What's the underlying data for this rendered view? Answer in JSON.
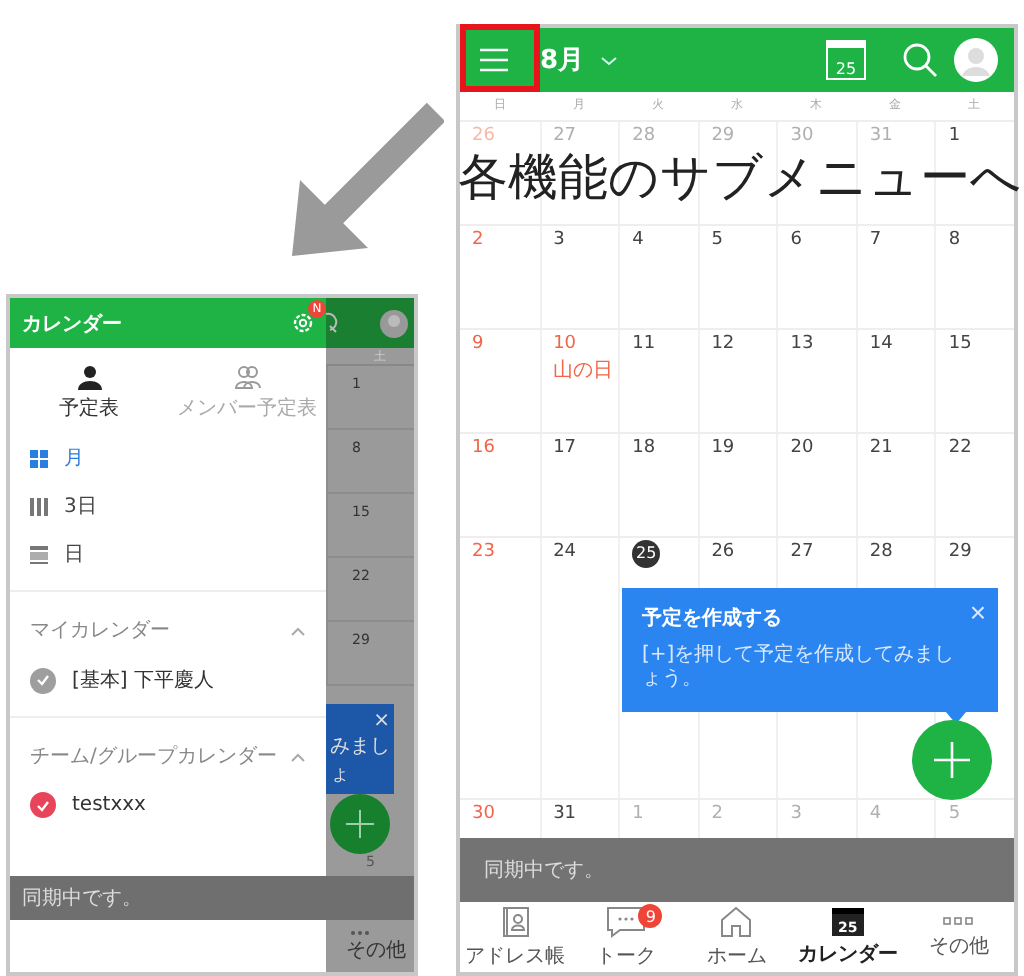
{
  "annotation": {
    "text": "各機能のサブメニューへ"
  },
  "drawer_screen": {
    "header_title": "カレンダー",
    "settings_badge": "N",
    "view_tabs": [
      {
        "label": "予定表",
        "selected": true,
        "kind": "single"
      },
      {
        "label": "メンバー予定表",
        "selected": false,
        "kind": "members"
      }
    ],
    "views": [
      {
        "label": "月",
        "selected": true,
        "kind": "month"
      },
      {
        "label": "3日",
        "selected": false,
        "kind": "three-day"
      },
      {
        "label": "日",
        "selected": false,
        "kind": "day"
      }
    ],
    "sections": [
      {
        "title": "マイカレンダー",
        "expanded": true,
        "calendars": [
          {
            "name": "[基本] 下平慶人",
            "color": "#9e9e9e"
          }
        ]
      },
      {
        "title": "チーム/グループカレンダー",
        "expanded": true,
        "calendars": [
          {
            "name": "testxxx",
            "color": "#e8455a"
          }
        ]
      }
    ],
    "background": {
      "weekday": "土",
      "dates": [
        "1",
        "8",
        "15",
        "22",
        "29"
      ],
      "tooltip_close": "×",
      "tooltip_fragment": "みましょ",
      "last_date": "5",
      "tab_label": "その他"
    },
    "status": "同期中です。"
  },
  "calendar_screen": {
    "month": "8月",
    "today_icon": "25",
    "weekdays": [
      "日",
      "月",
      "火",
      "水",
      "木",
      "金",
      "土"
    ],
    "weeks": [
      [
        {
          "date": "26",
          "kind": "sunday",
          "outside": true
        },
        {
          "date": "27",
          "kind": "weekday",
          "outside": true
        },
        {
          "date": "28",
          "kind": "weekday",
          "outside": true
        },
        {
          "date": "29",
          "kind": "weekday",
          "outside": true
        },
        {
          "date": "30",
          "kind": "weekday",
          "outside": true
        },
        {
          "date": "31",
          "kind": "weekday",
          "outside": true
        },
        {
          "date": "1",
          "kind": "weekday",
          "outside": false
        }
      ],
      [
        {
          "date": "2",
          "kind": "sunday",
          "outside": false
        },
        {
          "date": "3",
          "kind": "weekday",
          "outside": false
        },
        {
          "date": "4",
          "kind": "weekday",
          "outside": false
        },
        {
          "date": "5",
          "kind": "weekday",
          "outside": false
        },
        {
          "date": "6",
          "kind": "weekday",
          "outside": false
        },
        {
          "date": "7",
          "kind": "weekday",
          "outside": false
        },
        {
          "date": "8",
          "kind": "weekday",
          "outside": false
        }
      ],
      [
        {
          "date": "9",
          "kind": "sunday",
          "outside": false
        },
        {
          "date": "10",
          "kind": "holiday",
          "outside": false,
          "note": "山の日"
        },
        {
          "date": "11",
          "kind": "weekday",
          "outside": false
        },
        {
          "date": "12",
          "kind": "weekday",
          "outside": false
        },
        {
          "date": "13",
          "kind": "weekday",
          "outside": false
        },
        {
          "date": "14",
          "kind": "weekday",
          "outside": false
        },
        {
          "date": "15",
          "kind": "weekday",
          "outside": false
        }
      ],
      [
        {
          "date": "16",
          "kind": "sunday",
          "outside": false
        },
        {
          "date": "17",
          "kind": "weekday",
          "outside": false
        },
        {
          "date": "18",
          "kind": "weekday",
          "outside": false
        },
        {
          "date": "19",
          "kind": "weekday",
          "outside": false
        },
        {
          "date": "20",
          "kind": "weekday",
          "outside": false
        },
        {
          "date": "21",
          "kind": "weekday",
          "outside": false
        },
        {
          "date": "22",
          "kind": "weekday",
          "outside": false
        }
      ],
      [
        {
          "date": "23",
          "kind": "sunday",
          "outside": false
        },
        {
          "date": "24",
          "kind": "weekday",
          "outside": false
        },
        {
          "date": "25",
          "kind": "today",
          "outside": false
        },
        {
          "date": "26",
          "kind": "weekday",
          "outside": false
        },
        {
          "date": "27",
          "kind": "weekday",
          "outside": false
        },
        {
          "date": "28",
          "kind": "weekday",
          "outside": false
        },
        {
          "date": "29",
          "kind": "weekday",
          "outside": false
        }
      ],
      [
        {
          "date": "30",
          "kind": "sunday",
          "outside": false
        },
        {
          "date": "31",
          "kind": "weekday",
          "outside": false
        },
        {
          "date": "1",
          "kind": "weekday",
          "outside": true
        },
        {
          "date": "2",
          "kind": "weekday",
          "outside": true
        },
        {
          "date": "3",
          "kind": "weekday",
          "outside": true
        },
        {
          "date": "4",
          "kind": "weekday",
          "outside": true
        },
        {
          "date": "5",
          "kind": "weekday",
          "outside": true
        }
      ]
    ],
    "tooltip": {
      "title": "予定を作成する",
      "text": "[+]を押して予定を作成してみましょう。",
      "close": "×"
    },
    "status": "同期中です。",
    "tabs": [
      {
        "label": "アドレス帳",
        "kind": "address-book",
        "selected": false
      },
      {
        "label": "トーク",
        "kind": "talk",
        "selected": false,
        "badge": "9"
      },
      {
        "label": "ホーム",
        "kind": "home",
        "selected": false
      },
      {
        "label": "カレンダー",
        "kind": "calendar",
        "selected": true,
        "icon_text": "25"
      },
      {
        "label": "その他",
        "kind": "more",
        "selected": false
      }
    ]
  }
}
